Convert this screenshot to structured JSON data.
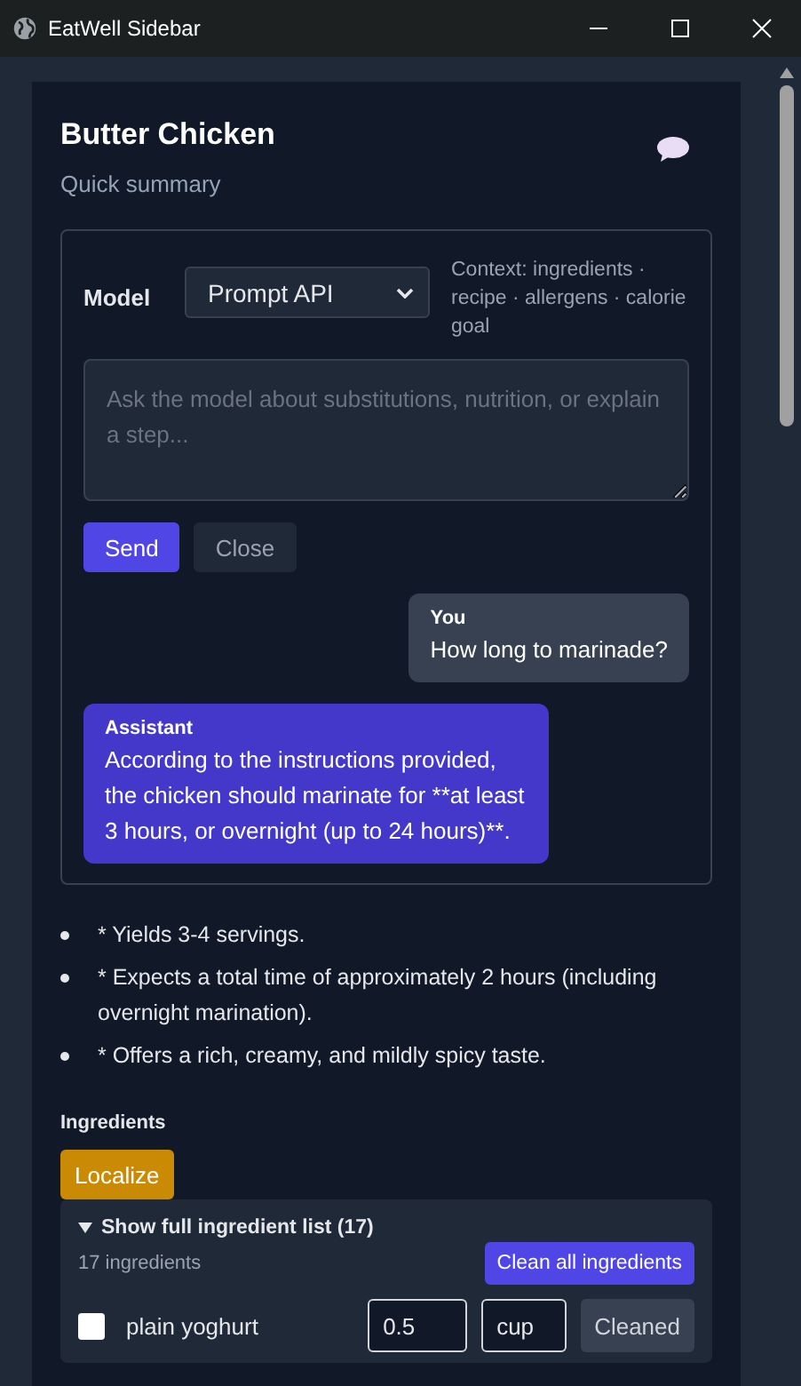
{
  "window": {
    "title": "EatWell Sidebar"
  },
  "header": {
    "title": "Butter Chicken",
    "subtitle": "Quick summary"
  },
  "chat": {
    "model_label": "Model",
    "model_value": "Prompt API",
    "context": "Context: ingredients · recipe · allergens · calorie goal",
    "placeholder": "Ask the model about substitutions, nutrition, or explain a step...",
    "send": "Send",
    "close": "Close",
    "messages": [
      {
        "kind": "user",
        "author": "You",
        "text": "How long to marinade?"
      },
      {
        "kind": "assistant",
        "author": "Assistant",
        "text": "According to the instructions provided, the chicken should marinate for **at least 3 hours, or overnight (up to 24 hours)**."
      }
    ]
  },
  "summary": [
    "* Yields 3-4 servings.",
    "* Expects a total time of approximately 2 hours (including overnight marination).",
    "* Offers a rich, creamy, and mildly spicy taste."
  ],
  "ingredients": {
    "heading": "Ingredients",
    "localize": "Localize",
    "expanded": true,
    "toggle": "Show full ingredient list (17)",
    "count": "17 ingredients",
    "clean_all": "Clean all ingredients",
    "items": [
      {
        "name": "plain yoghurt",
        "checked": false,
        "amount": "0.5",
        "unit": "cup",
        "action": "Cleaned"
      }
    ]
  }
}
